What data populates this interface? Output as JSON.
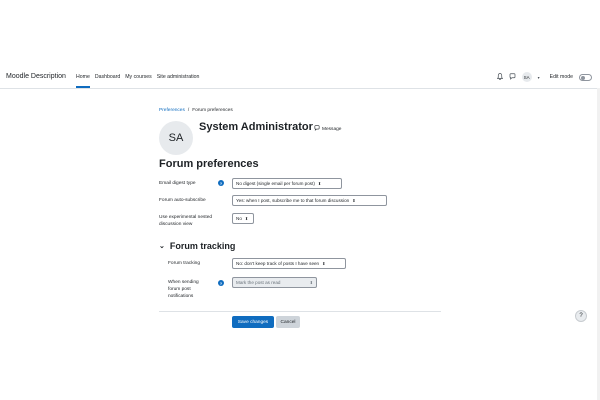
{
  "header": {
    "brand": "Moodle Description",
    "nav": [
      "Home",
      "Dashboard",
      "My courses",
      "Site administration"
    ],
    "user_initials": "SA",
    "edit_mode_label": "Edit mode"
  },
  "breadcrumb": {
    "parent": "Preferences",
    "separator": "/",
    "current": "Forum preferences"
  },
  "profile": {
    "initials": "SA",
    "name": "System Administrator",
    "message_label": "Message"
  },
  "page_title": "Forum preferences",
  "fields": {
    "email_digest": {
      "label": "Email digest type",
      "value": "No digest (single email per forum post)"
    },
    "auto_subscribe": {
      "label": "Forum auto-subscribe",
      "value": "Yes: when I post, subscribe me to that forum discussion"
    },
    "nested_view": {
      "label": "Use experimental nested discussion view",
      "value": "No"
    }
  },
  "tracking": {
    "section_title": "Forum tracking",
    "forum_tracking": {
      "label": "Forum tracking",
      "value": "No: don't keep track of posts I have seen"
    },
    "mark_read": {
      "label": "When sending forum post notifications",
      "value": "Mark the post as read"
    }
  },
  "buttons": {
    "save": "Save changes",
    "cancel": "Cancel"
  },
  "help_fab": "?",
  "colors": {
    "primary": "#0f6cbf",
    "border": "#dee2e6",
    "secondary_button": "#ced4da"
  },
  "icons": [
    "bell-icon",
    "chat-icon",
    "help-icon",
    "chevron-down-icon",
    "question-icon"
  ]
}
